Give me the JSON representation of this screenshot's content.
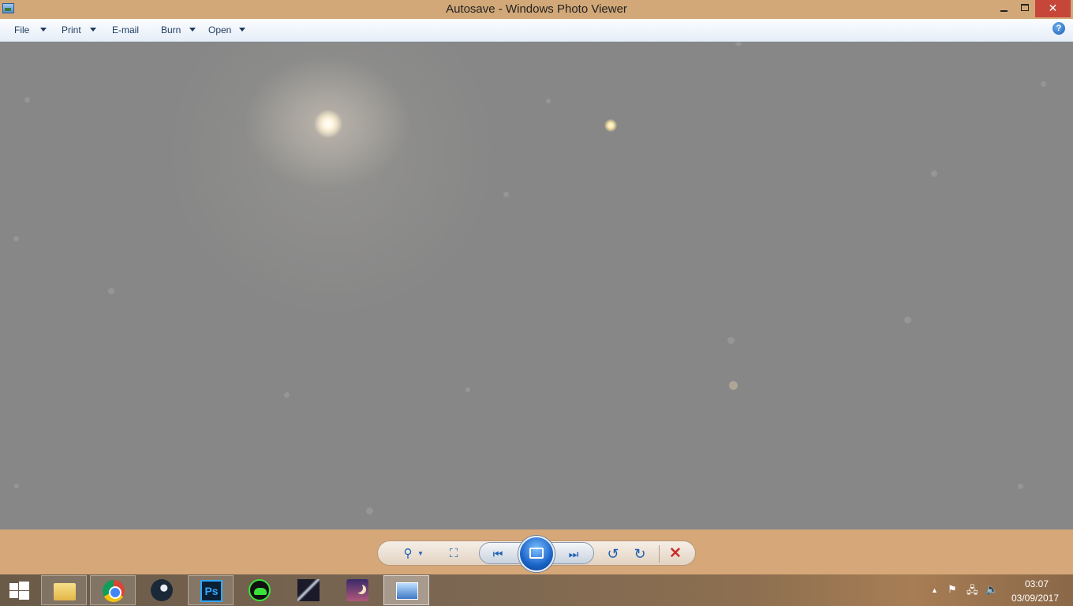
{
  "window": {
    "title": "Autosave - Windows Photo Viewer",
    "minimize_glyph": "",
    "close_glyph": "✕"
  },
  "menu": {
    "items": [
      {
        "label": "File",
        "has_dropdown": true
      },
      {
        "label": "Print",
        "has_dropdown": true
      },
      {
        "label": "E-mail",
        "has_dropdown": false
      },
      {
        "label": "Burn",
        "has_dropdown": true
      },
      {
        "label": "Open",
        "has_dropdown": true
      }
    ],
    "help_glyph": "?"
  },
  "photo": {
    "description_color": "#878787"
  },
  "controls": {
    "zoom_glyph": "⚲",
    "fit_glyph": "⛶",
    "prev_glyph": "⏮",
    "next_glyph": "⏭",
    "rotate_ccw_glyph": "↺",
    "rotate_cw_glyph": "↻",
    "delete_glyph": "✕"
  },
  "taskbar": {
    "apps": [
      {
        "icon": "file-explorer-icon"
      },
      {
        "icon": "chrome-icon"
      },
      {
        "icon": "steam-icon"
      },
      {
        "icon": "photoshop-icon",
        "text": "Ps"
      },
      {
        "icon": "cloud-sync-icon"
      },
      {
        "icon": "comet-image-icon"
      },
      {
        "icon": "stellarium-icon"
      },
      {
        "icon": "photo-viewer-icon"
      }
    ],
    "clock": {
      "time": "03:07",
      "date": "03/09/2017"
    }
  },
  "colors": {
    "title_bar": "#d2a878",
    "close_button": "#c7463a",
    "accent_blue": "#1a5fb4"
  }
}
